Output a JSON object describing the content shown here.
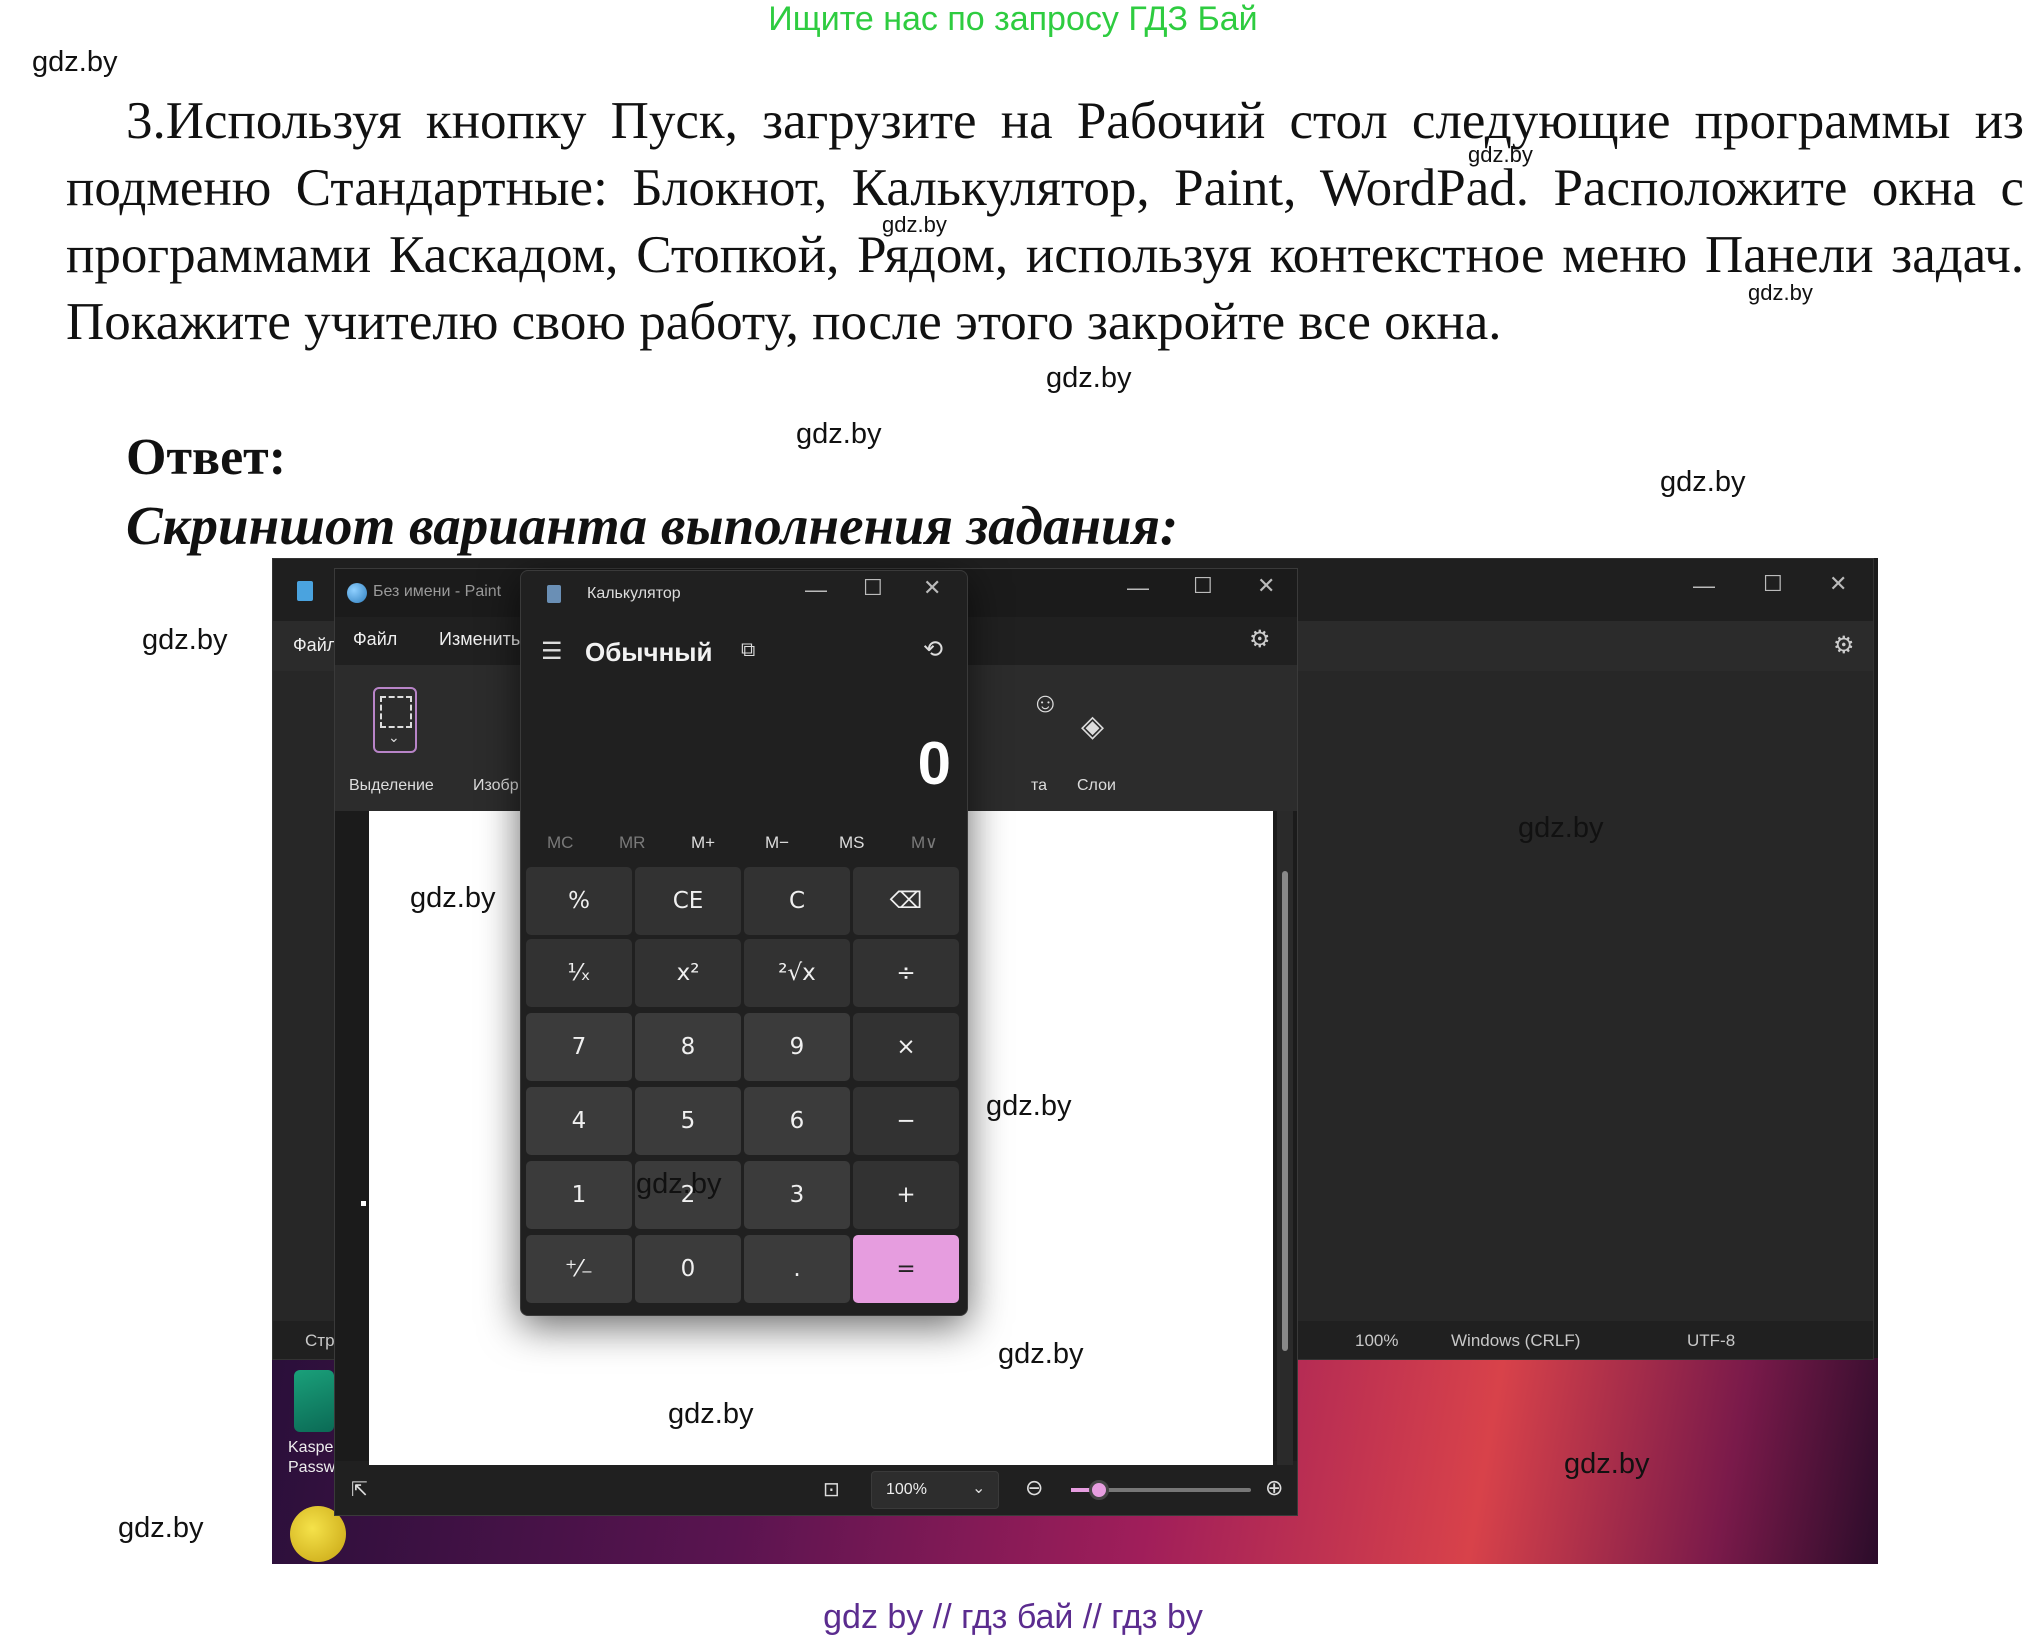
{
  "banner": "Ищите нас по запросу ГДЗ Бай",
  "task": {
    "text": "3.Используя кнопку Пуск, загрузите на Рабочий стол следующие программы из подменю Стандартные: Блокнот, Калькулятор, Paint, WordPad. Расположите окна с программами Каскадом, Стопкой, Рядом, используя контекстное меню Панели задач. Покажите учителю свою работу, после этого закройте все окна."
  },
  "answer_label": "Ответ:",
  "screenshot_caption": "Скриншот варианта выполнения задания:",
  "watermark": "gdz.by",
  "footer": "gdz by  //  гдз бай  //  гдз by",
  "screenshot": {
    "notepad": {
      "menu_file": "Файл",
      "status_line": "Стр",
      "status_zoom": "100%",
      "status_eol": "Windows (CRLF)",
      "status_encoding": "UTF-8",
      "settings_icon": "gear-icon"
    },
    "paint": {
      "title": "Без имени - Paint",
      "menu": [
        "Файл",
        "Изменить"
      ],
      "tools": {
        "select": "Выделение",
        "image": "Изобр",
        "palette": "та",
        "layers": "Слои"
      },
      "zoom": "100%"
    },
    "calculator": {
      "title": "Калькулятор",
      "mode": "Обычный",
      "display": "0",
      "memory": [
        {
          "label": "MC",
          "enabled": false
        },
        {
          "label": "MR",
          "enabled": false
        },
        {
          "label": "M+",
          "enabled": true
        },
        {
          "label": "M−",
          "enabled": true
        },
        {
          "label": "MS",
          "enabled": true
        },
        {
          "label": "M∨",
          "enabled": false
        }
      ],
      "keys": [
        [
          "%",
          "CE",
          "C",
          "⌫"
        ],
        [
          "¹⁄ₓ",
          "x²",
          "²√x",
          "÷"
        ],
        [
          "7",
          "8",
          "9",
          "×"
        ],
        [
          "4",
          "5",
          "6",
          "−"
        ],
        [
          "1",
          "2",
          "3",
          "+"
        ],
        [
          "⁺⁄₋",
          "0",
          ".",
          "="
        ]
      ],
      "accent": "#e69ddf"
    },
    "desktop": {
      "icon_label_1": "Kasper",
      "icon_label_2": "Passw"
    }
  }
}
